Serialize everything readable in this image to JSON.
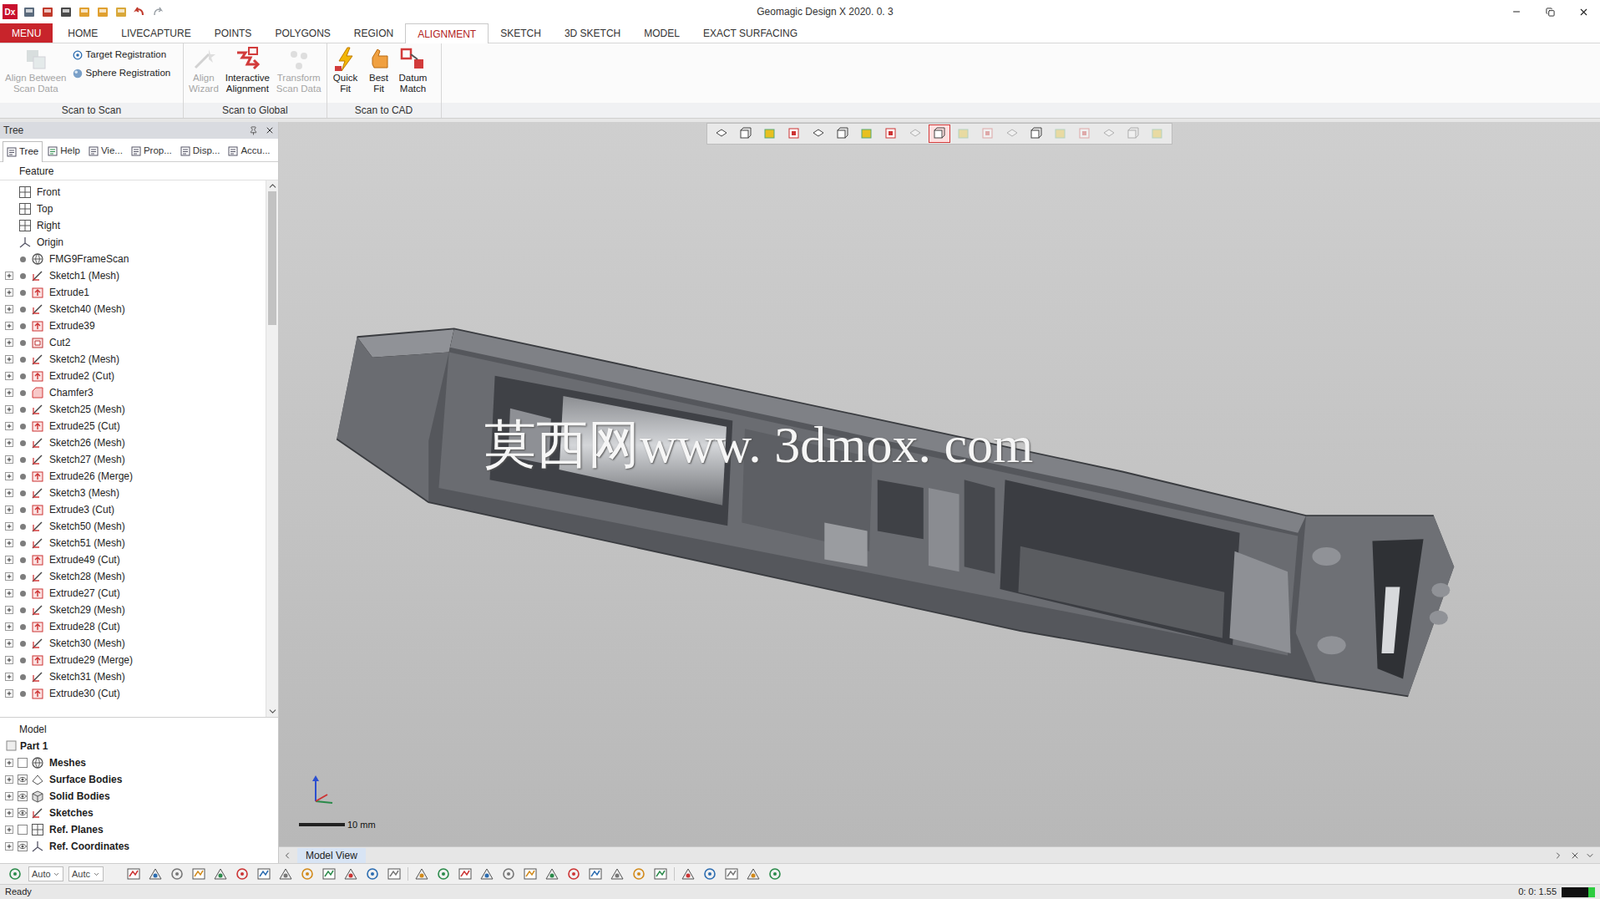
{
  "window": {
    "title": "Geomagic Design X 2020. 0. 3",
    "app_logo": "Dx"
  },
  "menu_tabs": [
    {
      "label": "MENU",
      "kind": "app",
      "selected": false
    },
    {
      "label": "HOME",
      "kind": "tab",
      "selected": false
    },
    {
      "label": "LIVECAPTURE",
      "kind": "tab",
      "selected": false
    },
    {
      "label": "POINTS",
      "kind": "tab",
      "selected": false
    },
    {
      "label": "POLYGONS",
      "kind": "tab",
      "selected": false
    },
    {
      "label": "REGION",
      "kind": "tab",
      "selected": false
    },
    {
      "label": "ALIGNMENT",
      "kind": "tab",
      "selected": true
    },
    {
      "label": "SKETCH",
      "kind": "tab",
      "selected": false
    },
    {
      "label": "3D SKETCH",
      "kind": "tab",
      "selected": false
    },
    {
      "label": "MODEL",
      "kind": "tab",
      "selected": false
    },
    {
      "label": "EXACT SURFACING",
      "kind": "tab",
      "selected": false
    }
  ],
  "ribbon": {
    "groups": [
      {
        "label": "Scan to Scan",
        "buttons": [
          {
            "label": [
              "Align Between",
              "Scan Data"
            ],
            "kind": "large",
            "disabled": true
          },
          {
            "label": [
              "Target Registration"
            ],
            "kind": "small",
            "disabled": false
          },
          {
            "label": [
              "Sphere Registration"
            ],
            "kind": "small",
            "disabled": false
          }
        ]
      },
      {
        "label": "Scan to Global",
        "buttons": [
          {
            "label": [
              "Align",
              "Wizard"
            ],
            "kind": "large",
            "disabled": true
          },
          {
            "label": [
              "Interactive",
              "Alignment"
            ],
            "kind": "large",
            "disabled": false
          },
          {
            "label": [
              "Transform",
              "Scan Data"
            ],
            "kind": "large",
            "disabled": true
          }
        ]
      },
      {
        "label": "Scan to CAD",
        "buttons": [
          {
            "label": [
              "Quick",
              "Fit"
            ],
            "kind": "large",
            "disabled": false
          },
          {
            "label": [
              "Best",
              "Fit"
            ],
            "kind": "large",
            "disabled": false
          },
          {
            "label": [
              "Datum",
              "Match"
            ],
            "kind": "large",
            "disabled": false
          }
        ]
      }
    ]
  },
  "tree_panel": {
    "title": "Tree",
    "tabs": [
      {
        "label": "Tree",
        "selected": true
      },
      {
        "label": "Help",
        "selected": false
      },
      {
        "label": "Vie...",
        "selected": false
      },
      {
        "label": "Prop...",
        "selected": false
      },
      {
        "label": "Disp...",
        "selected": false
      },
      {
        "label": "Accu...",
        "selected": false
      }
    ],
    "feature_header": "Feature",
    "scrollbar": {
      "level": 0.26
    },
    "features": [
      {
        "label": "Front",
        "kind": "plane",
        "visible": false,
        "expandable": false
      },
      {
        "label": "Top",
        "kind": "plane",
        "visible": false,
        "expandable": false
      },
      {
        "label": "Right",
        "kind": "plane",
        "visible": false,
        "expandable": false
      },
      {
        "label": "Origin",
        "kind": "origin",
        "visible": false,
        "expandable": false
      },
      {
        "label": "FMG9FrameScan",
        "kind": "mesh",
        "visible": true,
        "expandable": false
      },
      {
        "label": "Sketch1 (Mesh)",
        "kind": "sketch",
        "visible": true,
        "expandable": true
      },
      {
        "label": "Extrude1",
        "kind": "extrude",
        "visible": true,
        "expandable": true
      },
      {
        "label": "Sketch40 (Mesh)",
        "kind": "sketch",
        "visible": true,
        "expandable": true
      },
      {
        "label": "Extrude39",
        "kind": "extrude",
        "visible": true,
        "expandable": true
      },
      {
        "label": "Cut2",
        "kind": "cut",
        "visible": true,
        "expandable": true
      },
      {
        "label": "Sketch2 (Mesh)",
        "kind": "sketch",
        "visible": true,
        "expandable": true
      },
      {
        "label": "Extrude2 (Cut)",
        "kind": "extrude",
        "visible": true,
        "expandable": true
      },
      {
        "label": "Chamfer3",
        "kind": "chamfer",
        "visible": true,
        "expandable": true
      },
      {
        "label": "Sketch25 (Mesh)",
        "kind": "sketch",
        "visible": true,
        "expandable": true
      },
      {
        "label": "Extrude25 (Cut)",
        "kind": "extrude",
        "visible": true,
        "expandable": true
      },
      {
        "label": "Sketch26 (Mesh)",
        "kind": "sketch",
        "visible": true,
        "expandable": true
      },
      {
        "label": "Sketch27 (Mesh)",
        "kind": "sketch",
        "visible": true,
        "expandable": true
      },
      {
        "label": "Extrude26 (Merge)",
        "kind": "extrude",
        "visible": true,
        "expandable": true
      },
      {
        "label": "Sketch3 (Mesh)",
        "kind": "sketch",
        "visible": true,
        "expandable": true
      },
      {
        "label": "Extrude3 (Cut)",
        "kind": "extrude",
        "visible": true,
        "expandable": true
      },
      {
        "label": "Sketch50 (Mesh)",
        "kind": "sketch",
        "visible": true,
        "expandable": true
      },
      {
        "label": "Sketch51 (Mesh)",
        "kind": "sketch",
        "visible": true,
        "expandable": true
      },
      {
        "label": "Extrude49 (Cut)",
        "kind": "extrude",
        "visible": true,
        "expandable": true
      },
      {
        "label": "Sketch28 (Mesh)",
        "kind": "sketch",
        "visible": true,
        "expandable": true
      },
      {
        "label": "Extrude27 (Cut)",
        "kind": "extrude",
        "visible": true,
        "expandable": true
      },
      {
        "label": "Sketch29 (Mesh)",
        "kind": "sketch",
        "visible": true,
        "expandable": true
      },
      {
        "label": "Extrude28 (Cut)",
        "kind": "extrude",
        "visible": true,
        "expandable": true
      },
      {
        "label": "Sketch30 (Mesh)",
        "kind": "sketch",
        "visible": true,
        "expandable": true
      },
      {
        "label": "Extrude29 (Merge)",
        "kind": "extrude",
        "visible": true,
        "expandable": true
      },
      {
        "label": "Sketch31 (Mesh)",
        "kind": "sketch",
        "visible": true,
        "expandable": true
      },
      {
        "label": "Extrude30 (Cut)",
        "kind": "extrude",
        "visible": true,
        "expandable": true
      }
    ],
    "model_header": "Model",
    "model_items": [
      {
        "label": "Part 1",
        "kind": "part",
        "visible": false,
        "expandable": false
      },
      {
        "label": "Meshes",
        "kind": "mesh",
        "visible": false,
        "expandable": true
      },
      {
        "label": "Surface Bodies",
        "kind": "surface",
        "visible": true,
        "expandable": true
      },
      {
        "label": "Solid Bodies",
        "kind": "solid",
        "visible": true,
        "expandable": true
      },
      {
        "label": "Sketches",
        "kind": "sketch",
        "visible": true,
        "expandable": true
      },
      {
        "label": "Ref. Planes",
        "kind": "plane",
        "visible": false,
        "expandable": true
      },
      {
        "label": "Ref. Coordinates",
        "kind": "origin",
        "visible": true,
        "expandable": true
      }
    ]
  },
  "viewport": {
    "watermark": "莫西网www. 3dmox. com",
    "scale_label": "10 mm",
    "tab": "Model View",
    "toolbar": [
      {
        "disabled": false,
        "selected": false
      },
      {
        "disabled": false,
        "selected": false
      },
      {
        "disabled": false,
        "selected": false
      },
      {
        "disabled": false,
        "selected": false
      },
      {
        "disabled": false,
        "selected": false
      },
      {
        "disabled": false,
        "selected": false
      },
      {
        "disabled": false,
        "selected": false
      },
      {
        "disabled": false,
        "selected": false
      },
      {
        "disabled": true,
        "selected": false
      },
      {
        "disabled": false,
        "selected": true
      },
      {
        "disabled": true,
        "selected": false
      },
      {
        "disabled": true,
        "selected": false
      },
      {
        "disabled": true,
        "selected": false
      },
      {
        "disabled": false,
        "selected": false
      },
      {
        "disabled": true,
        "selected": false
      },
      {
        "disabled": true,
        "selected": false
      },
      {
        "disabled": true,
        "selected": false
      },
      {
        "disabled": true,
        "selected": false
      },
      {
        "disabled": true,
        "selected": false
      }
    ]
  },
  "bottom_toolbar": {
    "selectors": [
      "Auto",
      "Autc"
    ]
  },
  "status_bar": {
    "text": "Ready",
    "time": "0: 0: 1.55",
    "meter_level": 0.2
  }
}
